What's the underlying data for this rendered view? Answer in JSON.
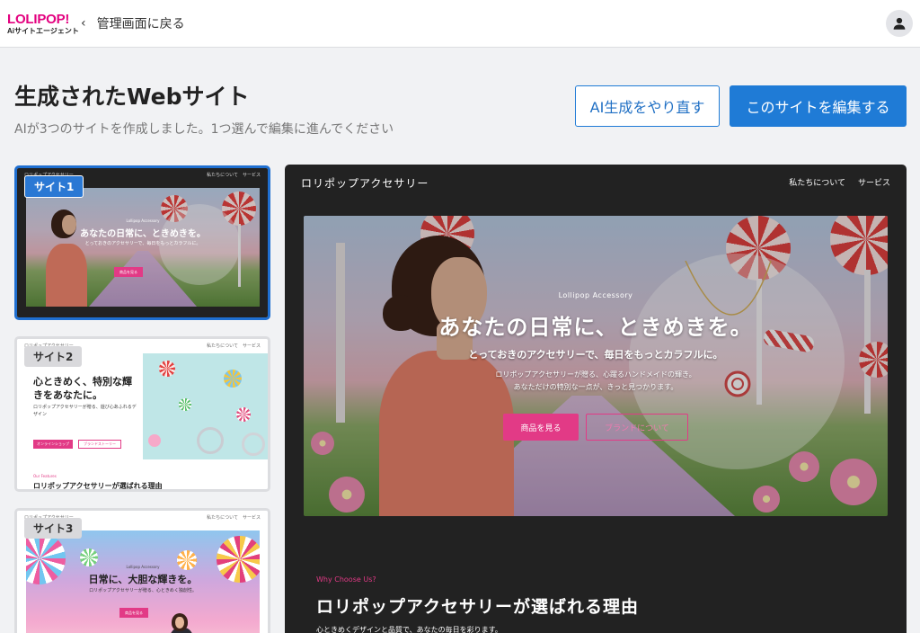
{
  "header": {
    "logo_main": "LOLIPOP!",
    "logo_sub": "Aiサイトエージェント",
    "back_label": "管理画面に戻る"
  },
  "page": {
    "title": "生成されたWebサイト",
    "subtitle": "AIが3つのサイトを作成しました。1つ選んで編集に進んでください",
    "regenerate_label": "AI生成をやり直す",
    "edit_label": "このサイトを編集する"
  },
  "thumbnails": [
    {
      "label": "サイト1",
      "selected": true,
      "nav_left": "ロリポップアクセサリー",
      "nav_right": "私たちについて　サービス",
      "eyebrow": "Lollipop Accessory",
      "title": "あなたの日常に、ときめきを。",
      "sub": "とっておきのアクセサリーで、毎日をもっとカラフルに。",
      "btn": "商品を見る"
    },
    {
      "label": "サイト2",
      "selected": false,
      "nav_left": "ロリポップアクセサリー",
      "nav_right": "私たちについて　サービス",
      "title": "心ときめく、特別な輝きをあなたに。",
      "sub": "ロリポップアクセサリーが贈る、遊び心あふれるデザイン",
      "btn1": "オンラインショップ",
      "btn2": "ブランドストーリー",
      "section_eyebrow": "Our Features",
      "section_title": "ロリポップアクセサリーが選ばれる理由"
    },
    {
      "label": "サイト3",
      "selected": false,
      "nav_left": "ロリポップアクセサリー",
      "nav_right": "私たちについて　サービス",
      "eyebrow": "Lollipop Accessory",
      "title": "日常に、大胆な輝きを。",
      "sub": "ロリポップアクセサリーが贈る、心ときめく独創性。",
      "btn": "商品を見る"
    }
  ],
  "preview": {
    "brand": "ロリポップアクセサリー",
    "nav": [
      "私たちについて",
      "サービス"
    ],
    "eyebrow": "Lollipop Accessory",
    "title": "あなたの日常に、ときめきを。",
    "subtitle": "とっておきのアクセサリーで、毎日をもっとカラフルに。",
    "desc_line1": "ロリポップアクセサリーが贈る、心躍るハンドメイドの輝き。",
    "desc_line2": "あなただけの特別な一点が、きっと見つかります。",
    "btn_primary": "商品を見る",
    "btn_secondary": "ブランドについて",
    "section_eyebrow": "Why Choose Us?",
    "section_title": "ロリポップアクセサリーが選ばれる理由",
    "section_desc": "心ときめくデザインと品質で、あなたの毎日を彩ります。"
  },
  "colors": {
    "brand_pink": "#e3007f",
    "primary_blue": "#1f7bd6",
    "accent_pink": "#e23a86"
  }
}
